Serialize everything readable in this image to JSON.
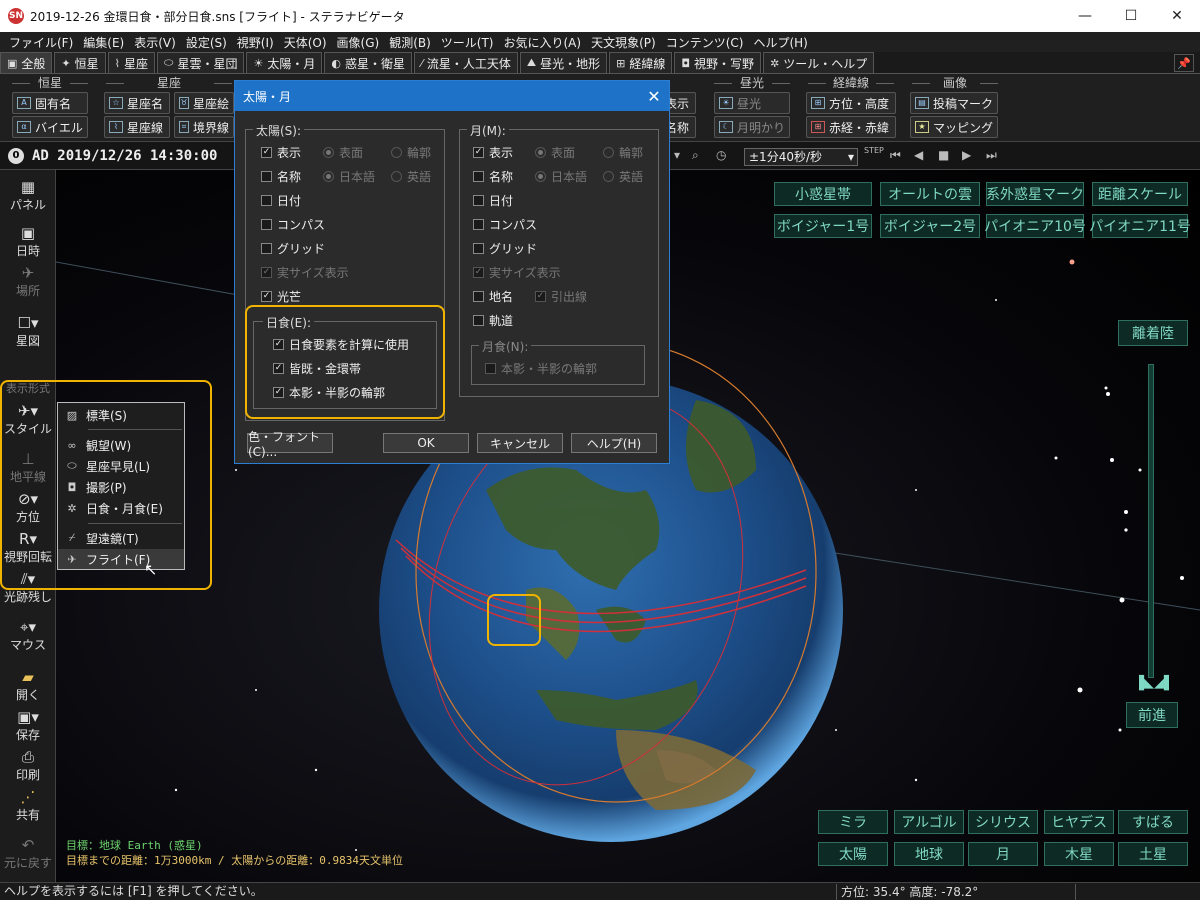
{
  "window": {
    "title": "2019-12-26 金環日食・部分日食.sns [フライト] - ステラナビゲータ",
    "app_icon": "SN",
    "minimize": "—",
    "maximize": "☐",
    "close": "✕"
  },
  "menu": [
    "ファイル(F)",
    "編集(E)",
    "表示(V)",
    "設定(S)",
    "視野(I)",
    "天体(O)",
    "画像(G)",
    "観測(B)",
    "ツール(T)",
    "お気に入り(A)",
    "天文現象(P)",
    "コンテンツ(C)",
    "ヘルプ(H)"
  ],
  "tabs": [
    "全般",
    "恒星",
    "星座",
    "星雲・星団",
    "太陽・月",
    "惑星・衛星",
    "流星・人工天体",
    "昼光・地形",
    "経緯線",
    "視野・写野",
    "ツール・ヘルプ"
  ],
  "pin_label": "📌",
  "ribbon": {
    "groups": {
      "stars": "恒星",
      "constellations": "星座",
      "daylight": "昼光",
      "gridlines": "経緯線",
      "images": "画像"
    },
    "buttons": {
      "proper_name": "固有名",
      "bayer": "バイエル",
      "const_name": "星座名",
      "const_lines": "星座線",
      "const_pic": "星座絵",
      "boundary": "境界線",
      "show": "表示",
      "name": "名称",
      "daylight": "昼光",
      "moonlight": "月明かり",
      "azalt": "方位・高度",
      "radec": "赤経・赤緯",
      "post_mark": "投稿マーク",
      "mapping": "マッピング"
    }
  },
  "time": {
    "indicator": "0",
    "datetime": "AD 2019/12/26 14:30:00",
    "speed": "±1分40秒/秒",
    "step": "STEP"
  },
  "left_toolbar": {
    "panel": "パネル",
    "datetime": "日時",
    "place": "場所",
    "starmap": "星図",
    "display_mode": "表示形式",
    "style": "スタイル",
    "horizon": "地平線",
    "direction": "方位",
    "rotation": "視野回転",
    "trail": "光跡残し",
    "mouse": "マウス",
    "open": "開く",
    "save": "保存",
    "print": "印刷",
    "share": "共有",
    "undo": "元に戻す"
  },
  "style_menu": {
    "standard": "標準(S)",
    "binocular": "観望(W)",
    "quicklook": "星座早見(L)",
    "photo": "撮影(P)",
    "eclipse": "日食・月食(E)",
    "telescope": "望遠鏡(T)",
    "flight": "フライト(F)"
  },
  "dialog": {
    "title": "太陽・月",
    "sun_group": "太陽(S):",
    "moon_group": "月(M):",
    "sun": {
      "show": "表示",
      "surface": "表面",
      "outline": "輪郭",
      "name": "名称",
      "japanese": "日本語",
      "english": "英語",
      "date": "日付",
      "compass": "コンパス",
      "grid": "グリッド",
      "real_size": "実サイズ表示",
      "glare": "光芒"
    },
    "moon": {
      "show": "表示",
      "surface": "表面",
      "outline": "輪郭",
      "name": "名称",
      "japanese": "日本語",
      "english": "英語",
      "date": "日付",
      "compass": "コンパス",
      "grid": "グリッド",
      "real_size": "実サイズ表示",
      "place_name": "地名",
      "leader": "引出線",
      "orbit": "軌道"
    },
    "eclipse_group": "日食(E):",
    "eclipse": {
      "use_elements": "日食要素を計算に使用",
      "total_annular": "皆既・金環帯",
      "umbra_penumbra": "本影・半影の輪郭"
    },
    "lunar_eclipse_group": "月食(N):",
    "lunar_eclipse": {
      "umbra_penumbra": "本影・半影の輪郭"
    },
    "buttons": {
      "color_font": "色・フォント(C)...",
      "ok": "OK",
      "cancel": "キャンセル",
      "help": "ヘルプ(H)"
    }
  },
  "overlay_buttons": {
    "top_row1": [
      "小惑星帯",
      "オールトの雲",
      "系外惑星マーク",
      "距離スケール"
    ],
    "top_row2": [
      "ボイジャー1号",
      "ボイジャー2号",
      "パイオニア10号",
      "パイオニア11号"
    ],
    "bottom_row1": [
      "ミラ",
      "アルゴル",
      "シリウス",
      "ヒヤデス",
      "すばる"
    ],
    "bottom_row2": [
      "太陽",
      "地球",
      "月",
      "木星",
      "土星"
    ],
    "takeoff": "離着陸",
    "forward": "前進"
  },
  "info": {
    "target": "目標：地球 Earth (惑星)",
    "distance": "目標までの距離：1万3000km / 太陽からの距離：0.9834天文単位"
  },
  "status": {
    "help": "ヘルプを表示するには [F1] を押してください。",
    "coords": "方位:  35.4° 高度: -78.2°"
  }
}
